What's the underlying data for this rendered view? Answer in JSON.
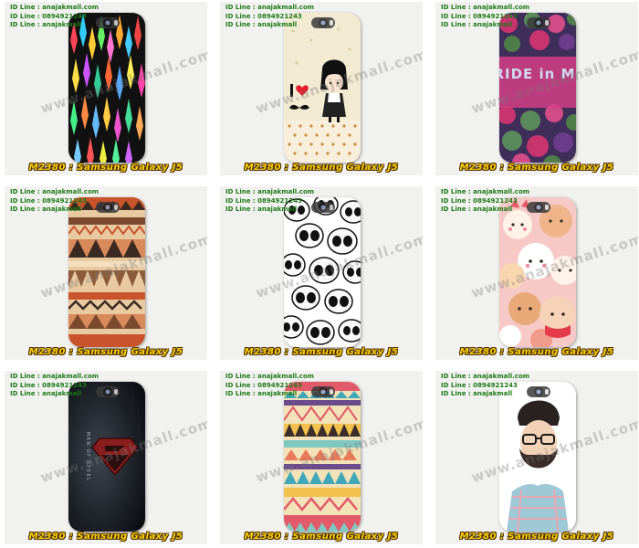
{
  "contact": {
    "line1": "ID Line : anajakmall.com",
    "line2": "ID Line : 0894921243",
    "line3": "ID Line : anajakmall"
  },
  "watermark": "www.anajakmall.com",
  "products": [
    {
      "model_label": "M2380 : Samsung Galaxy J5",
      "design": "colorful-diamonds"
    },
    {
      "model_label": "M2380 : Samsung Galaxy J5",
      "design": "i-love-mustache-girl"
    },
    {
      "model_label": "M2380 : Samsung Galaxy J5",
      "design": "pride-in-me-roses",
      "art_text": "PRIDE in ME!"
    },
    {
      "model_label": "M2380 : Samsung Galaxy J5",
      "design": "tribal-aztec-orange"
    },
    {
      "model_label": "M2380 : Samsung Galaxy J5",
      "design": "cartoon-skulls"
    },
    {
      "model_label": "M2380 : Samsung Galaxy J5",
      "design": "cute-animals-pink"
    },
    {
      "model_label": "M2380 : Samsung Galaxy J5",
      "design": "man-of-steel",
      "art_text": "MAN OF STEEL"
    },
    {
      "model_label": "M2380 : Samsung Galaxy J5",
      "design": "tribal-aztec-pastel"
    },
    {
      "model_label": "M2380 : Samsung Galaxy J5",
      "design": "hipster-bearded-man"
    }
  ]
}
